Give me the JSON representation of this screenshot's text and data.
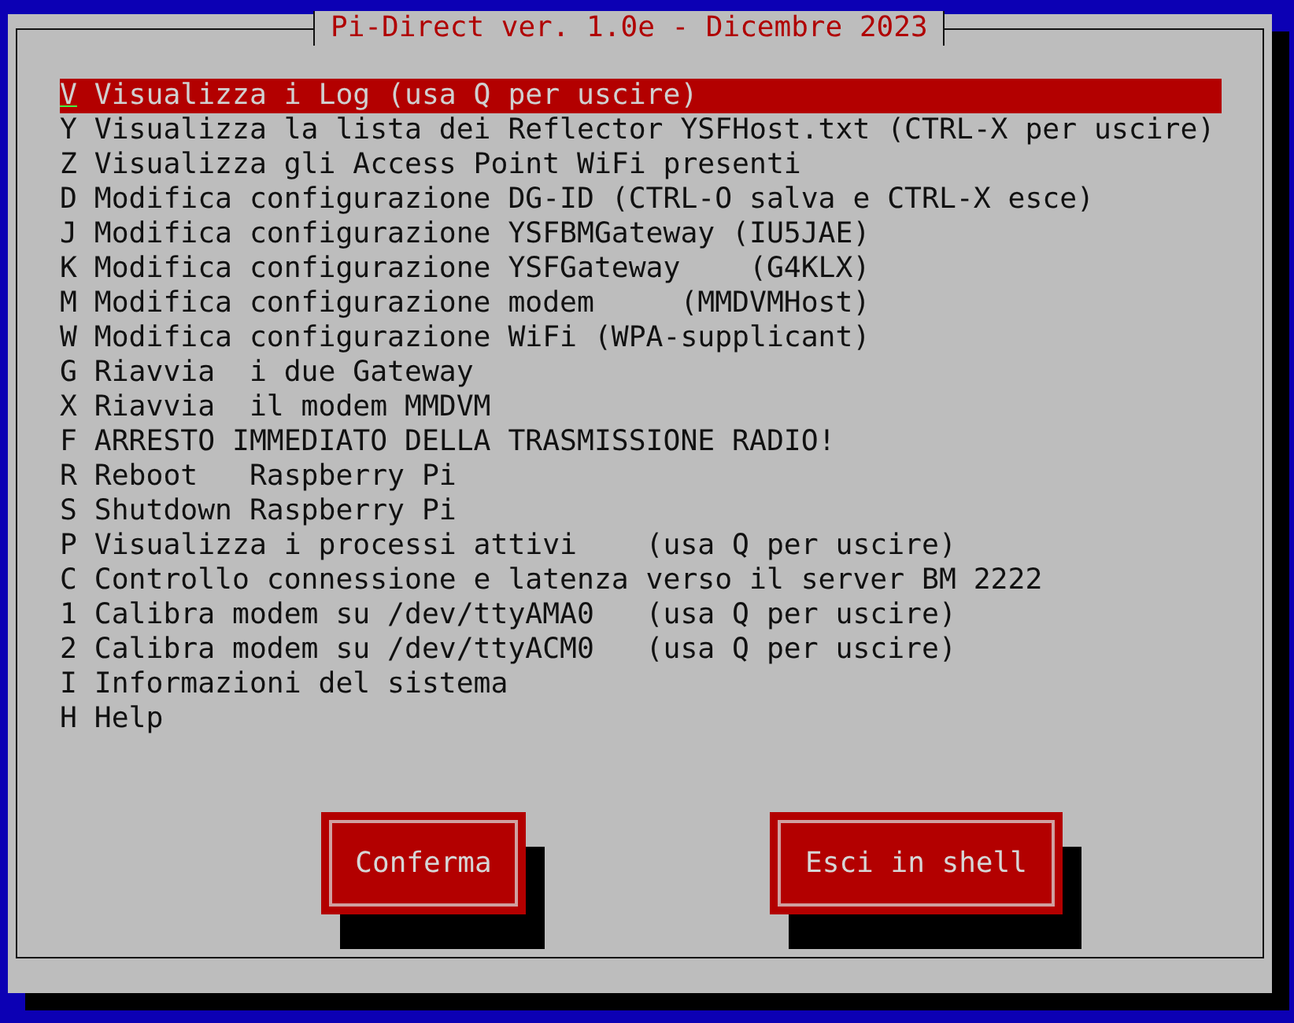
{
  "dialog": {
    "title": "Pi-Direct ver. 1.0e - Dicembre 2023"
  },
  "menu": [
    {
      "tag": "V",
      "label": "Visualizza i Log (usa Q per uscire)",
      "selected": true
    },
    {
      "tag": "Y",
      "label": "Visualizza la lista dei Reflector YSFHost.txt (CTRL-X per uscire)",
      "selected": false
    },
    {
      "tag": "Z",
      "label": "Visualizza gli Access Point WiFi presenti",
      "selected": false
    },
    {
      "tag": "D",
      "label": "Modifica configurazione DG-ID (CTRL-O salva e CTRL-X esce)",
      "selected": false
    },
    {
      "tag": "J",
      "label": "Modifica configurazione YSFBMGateway (IU5JAE)",
      "selected": false
    },
    {
      "tag": "K",
      "label": "Modifica configurazione YSFGateway    (G4KLX)",
      "selected": false
    },
    {
      "tag": "M",
      "label": "Modifica configurazione modem     (MMDVMHost)",
      "selected": false
    },
    {
      "tag": "W",
      "label": "Modifica configurazione WiFi (WPA-supplicant)",
      "selected": false
    },
    {
      "tag": "G",
      "label": "Riavvia  i due Gateway",
      "selected": false
    },
    {
      "tag": "X",
      "label": "Riavvia  il modem MMDVM",
      "selected": false
    },
    {
      "tag": "F",
      "label": "ARRESTO IMMEDIATO DELLA TRASMISSIONE RADIO!",
      "selected": false
    },
    {
      "tag": "R",
      "label": "Reboot   Raspberry Pi",
      "selected": false
    },
    {
      "tag": "S",
      "label": "Shutdown Raspberry Pi",
      "selected": false
    },
    {
      "tag": "P",
      "label": "Visualizza i processi attivi    (usa Q per uscire)",
      "selected": false
    },
    {
      "tag": "C",
      "label": "Controllo connessione e latenza verso il server BM 2222",
      "selected": false
    },
    {
      "tag": "1",
      "label": "Calibra modem su /dev/ttyAMA0   (usa Q per uscire)",
      "selected": false
    },
    {
      "tag": "2",
      "label": "Calibra modem su /dev/ttyACM0   (usa Q per uscire)",
      "selected": false
    },
    {
      "tag": "I",
      "label": "Informazioni del sistema",
      "selected": false
    },
    {
      "tag": "H",
      "label": "Help",
      "selected": false
    }
  ],
  "buttons": [
    {
      "label": "Conferma"
    },
    {
      "label": "Esci in shell"
    }
  ]
}
